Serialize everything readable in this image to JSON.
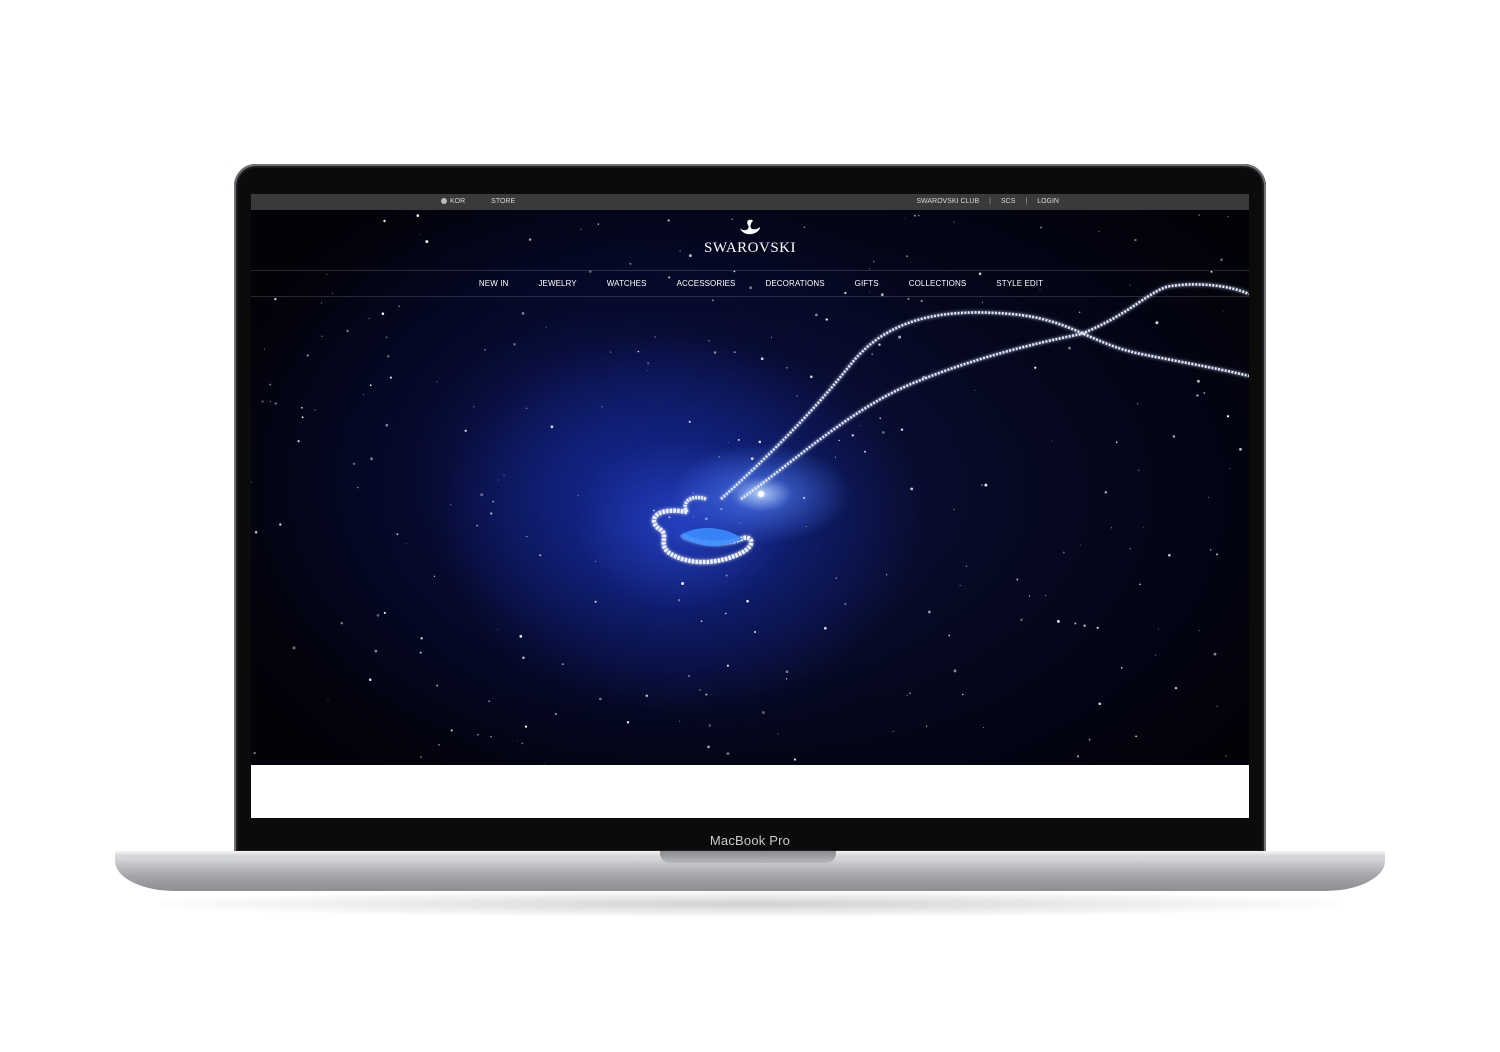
{
  "device": {
    "label": "MacBook Pro"
  },
  "site": {
    "utility_bar": {
      "language": "KOR",
      "store": "STORE",
      "club": "SWAROVSKI CLUB",
      "scs": "SCS",
      "login": "LOGIN",
      "separator": "|"
    },
    "logo": {
      "text": "SWAROVSKI",
      "icon": "swan-icon"
    },
    "nav": {
      "items": [
        "NEW IN",
        "JEWELRY",
        "WATCHES",
        "ACCESSORIES",
        "DECORATIONS",
        "GIFTS",
        "COLLECTIONS",
        "STYLE EDIT"
      ]
    },
    "hero": {
      "image": "swan-necklace-in-blue-galaxy"
    }
  },
  "colors": {
    "utility_bar_bg": "#3a3a3c",
    "hero_blue": "#2a46d2",
    "page_bg": "#ffffff"
  }
}
